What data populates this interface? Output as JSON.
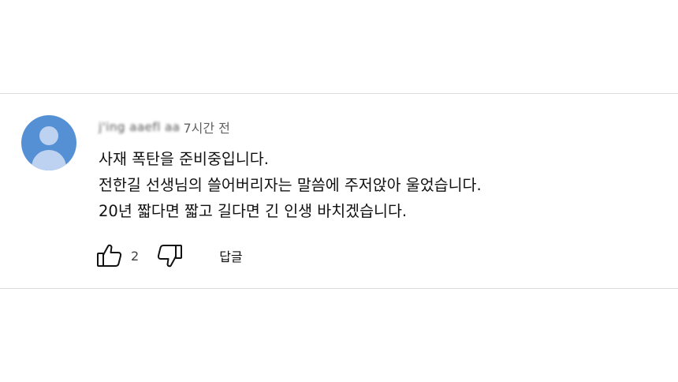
{
  "comment": {
    "author": "j'ing aaefl aa",
    "time": "7시간 전",
    "lines": [
      "사재 폭탄을 준비중입니다.",
      "전한길 선생님의 쓸어버리자는 말씀에 주저앉아 울었습니다.",
      "20년 짧다면 짧고 길다면 긴 인생 바치겠습니다."
    ],
    "like_count": "2",
    "reply_label": "답글",
    "avatar_color": "#5590d4",
    "icons": {
      "like": "thumbs-up-icon",
      "dislike": "thumbs-down-icon"
    }
  }
}
